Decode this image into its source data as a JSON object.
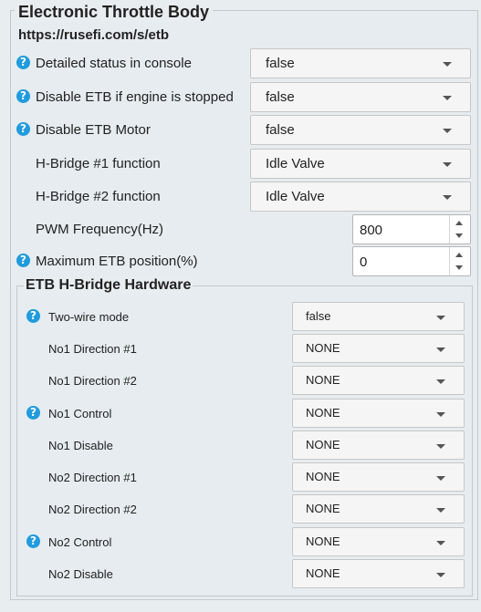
{
  "panel": {
    "title": "Electronic Throttle Body",
    "url": "https://rusefi.com/s/etb",
    "fields": [
      {
        "label": "Detailed status in console",
        "value": "false",
        "help": "?"
      },
      {
        "label": "Disable ETB if engine is stopped",
        "value": "false",
        "help": "?"
      },
      {
        "label": "Disable ETB Motor",
        "value": "false",
        "help": "?"
      },
      {
        "label": "H-Bridge #1 function",
        "value": "Idle Valve"
      },
      {
        "label": "H-Bridge #2 function",
        "value": "Idle Valve"
      },
      {
        "label": "PWM Frequency(Hz)",
        "value": "800"
      },
      {
        "label": "Maximum ETB position(%)",
        "value": "0",
        "help": "?"
      }
    ]
  },
  "hbridge": {
    "title": "ETB H-Bridge Hardware",
    "fields": [
      {
        "label": "Two-wire mode",
        "value": "false",
        "help": "?"
      },
      {
        "label": "No1 Direction #1",
        "value": "NONE"
      },
      {
        "label": "No1 Direction #2",
        "value": "NONE"
      },
      {
        "label": "No1 Control",
        "value": "NONE",
        "help": "?"
      },
      {
        "label": "No1 Disable",
        "value": "NONE"
      },
      {
        "label": "No2 Direction #1",
        "value": "NONE"
      },
      {
        "label": "No2 Direction #2",
        "value": "NONE"
      },
      {
        "label": "No2 Control",
        "value": "NONE",
        "help": "?"
      },
      {
        "label": "No2 Disable",
        "value": "NONE"
      }
    ]
  },
  "colors": {
    "help_icon": "#1f9bde",
    "background": "#e8edf0"
  }
}
